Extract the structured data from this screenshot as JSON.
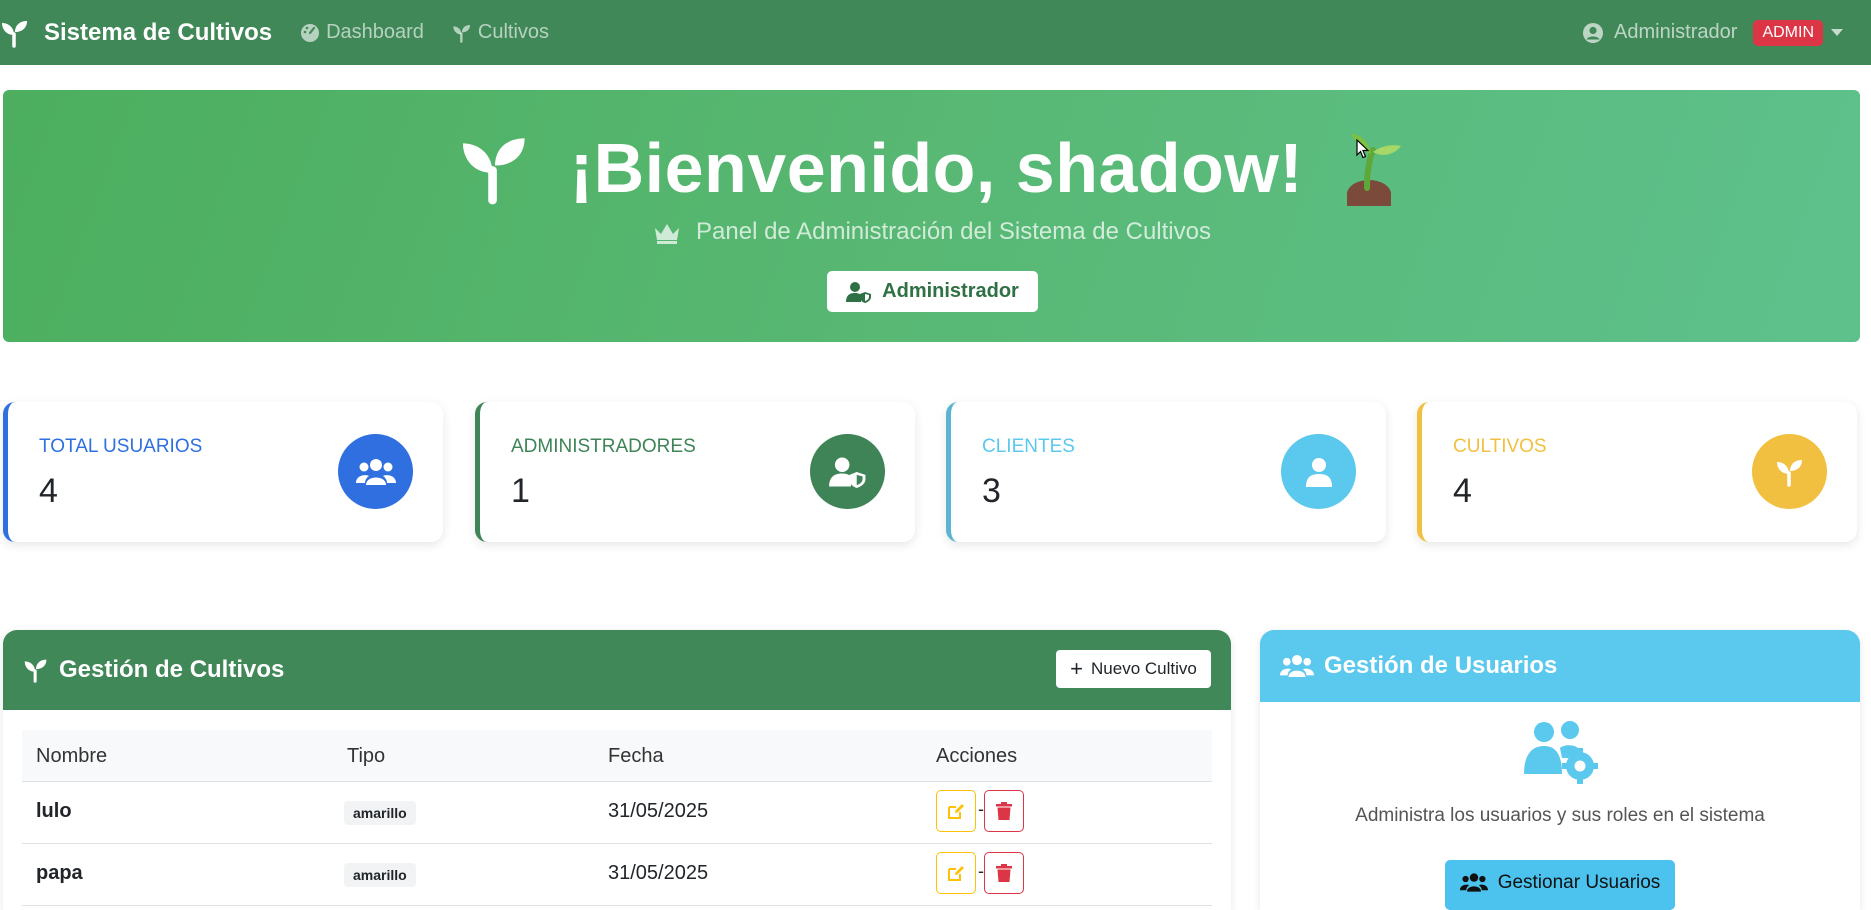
{
  "navbar": {
    "brand": "Sistema de Cultivos",
    "links": [
      {
        "label": "Dashboard",
        "icon": "dashboard-gauge-icon"
      },
      {
        "label": "Cultivos",
        "icon": "seedling-icon"
      }
    ],
    "user": "Administrador",
    "role_badge": "ADMIN"
  },
  "hero": {
    "title": "¡Bienvenido, shadow!",
    "subtitle": "Panel de Administración del Sistema de Cultivos",
    "role_button": "Administrador"
  },
  "stats": [
    {
      "label": "TOTAL USUARIOS",
      "value": "4",
      "color": "#2f6fe0",
      "icon": "users-icon"
    },
    {
      "label": "ADMINISTRADORES",
      "value": "1",
      "color": "#3e8456",
      "icon": "user-shield-icon"
    },
    {
      "label": "CLIENTES",
      "value": "3",
      "color": "#5bc8ed",
      "icon": "user-icon"
    },
    {
      "label": "CULTIVOS",
      "value": "4",
      "color": "#f1c040",
      "icon": "seedling-icon"
    }
  ],
  "cultivos_panel": {
    "title": "Gestión de Cultivos",
    "new_button": "Nuevo Cultivo",
    "columns": [
      "Nombre",
      "Tipo",
      "Fecha",
      "Acciones"
    ],
    "rows": [
      {
        "nombre": "lulo",
        "tipo": "amarillo",
        "fecha": "31/05/2025"
      },
      {
        "nombre": "papa",
        "tipo": "amarillo",
        "fecha": "31/05/2025"
      }
    ],
    "action_separator": "-"
  },
  "usuarios_panel": {
    "title": "Gestión de Usuarios",
    "description": "Administra los usuarios y sus roles en el sistema",
    "button": "Gestionar Usuarios"
  },
  "colors": {
    "navbar": "#418858",
    "hero_start": "#4cae5e",
    "hero_end": "#5ec18c",
    "danger": "#dc3545",
    "warning": "#ffc107",
    "info": "#5bc8ed"
  }
}
